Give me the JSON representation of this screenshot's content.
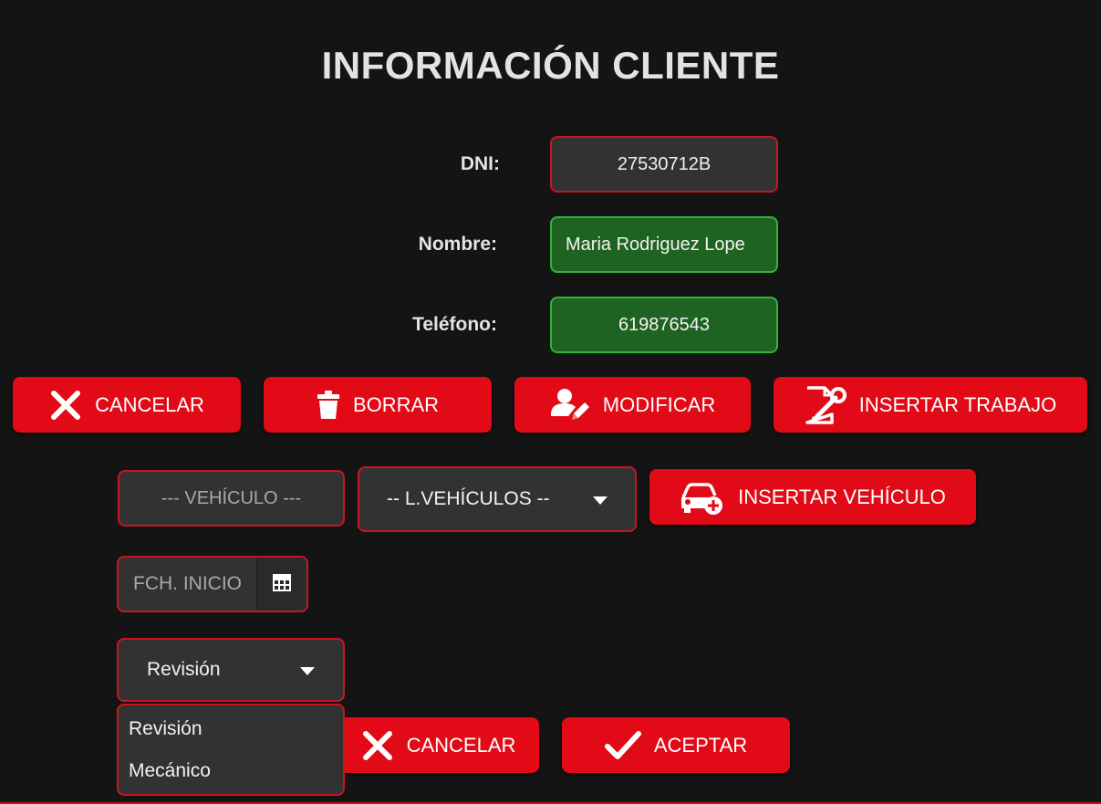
{
  "title": "INFORMACIÓN CLIENTE",
  "form": {
    "dni_label": "DNI:",
    "dni_value": "27530712B",
    "nombre_label": "Nombre:",
    "nombre_value": "Maria Rodriguez Lope",
    "telefono_label": "Teléfono:",
    "telefono_value": "619876543"
  },
  "actions": {
    "cancel": "CANCELAR",
    "delete": "BORRAR",
    "modify": "MODIFICAR",
    "insert_work": "INSERTAR TRABAJO"
  },
  "vehicle": {
    "placeholder": "--- VEHÍCULO ---",
    "list_selected": "-- L.VEHÍCULOS --",
    "insert_button": "INSERTAR VEHÍCULO"
  },
  "date": {
    "placeholder": "FCH. INICIO"
  },
  "work_type": {
    "selected": "Revisión",
    "options": [
      "Revisión",
      "Mecánico"
    ]
  },
  "bottom_actions": {
    "cancel": "CANCELAR",
    "accept": "ACEPTAR"
  },
  "colors": {
    "background": "#141414",
    "accent": "#e20a16",
    "valid_field": "#1f6323",
    "invalid_border": "#c8161e"
  },
  "icons": {
    "cancel": "close-icon",
    "delete": "trash-icon",
    "modify": "edit-user-icon",
    "insert_work": "document-wrench-icon",
    "insert_vehicle": "car-add-icon",
    "date": "calendar-icon",
    "accept": "check-icon"
  }
}
